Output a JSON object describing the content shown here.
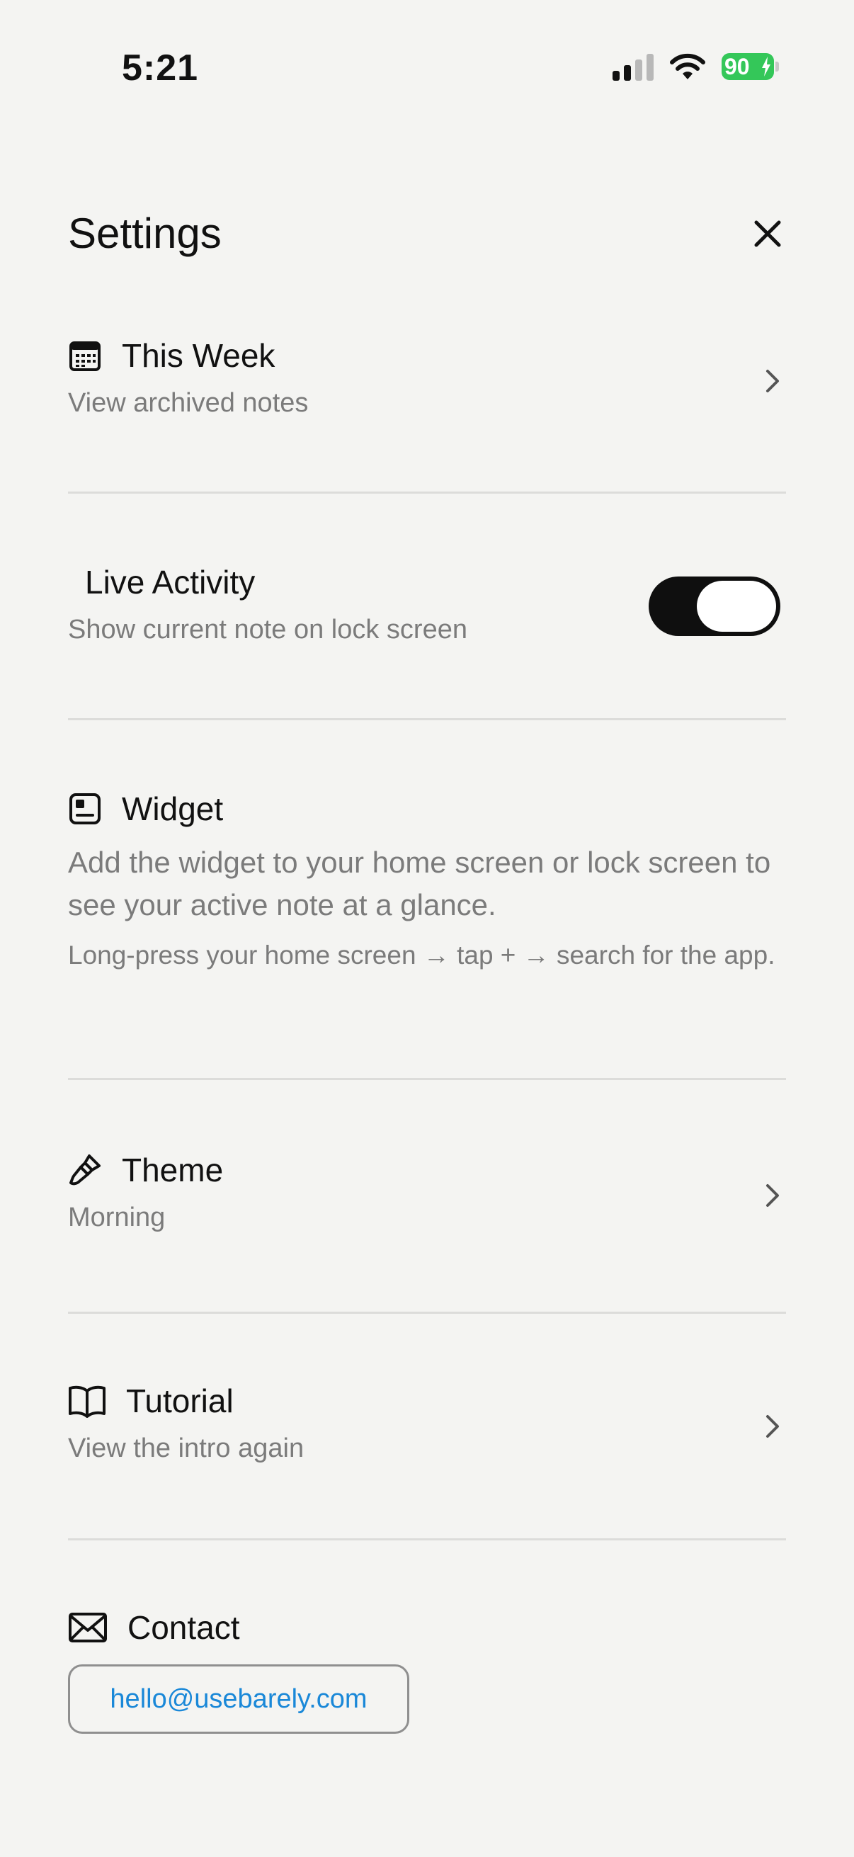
{
  "status_bar": {
    "time": "5:21",
    "battery_level": "90",
    "battery_color": "#34c759"
  },
  "header": {
    "title": "Settings",
    "close_icon": "close-icon"
  },
  "rows": {
    "this_week": {
      "title": "This Week",
      "subtitle": "View archived notes",
      "icon": "calendar-icon"
    },
    "live_activity": {
      "title": "Live Activity",
      "subtitle": "Show current note on lock screen",
      "toggle_on": true
    },
    "widget": {
      "title": "Widget",
      "icon": "widget-icon",
      "description": "Add the widget to your home screen or lock screen to see your active note at a glance.",
      "hint": "Long-press your home screen → tap + → search for the app."
    },
    "theme": {
      "title": "Theme",
      "subtitle": "Morning",
      "icon": "paintbrush-icon"
    },
    "tutorial": {
      "title": "Tutorial",
      "subtitle": "View the intro again",
      "icon": "book-icon"
    },
    "contact": {
      "title": "Contact",
      "email": "hello@usebarely.com",
      "icon": "envelope-icon",
      "link_color": "#1a88d8"
    }
  }
}
